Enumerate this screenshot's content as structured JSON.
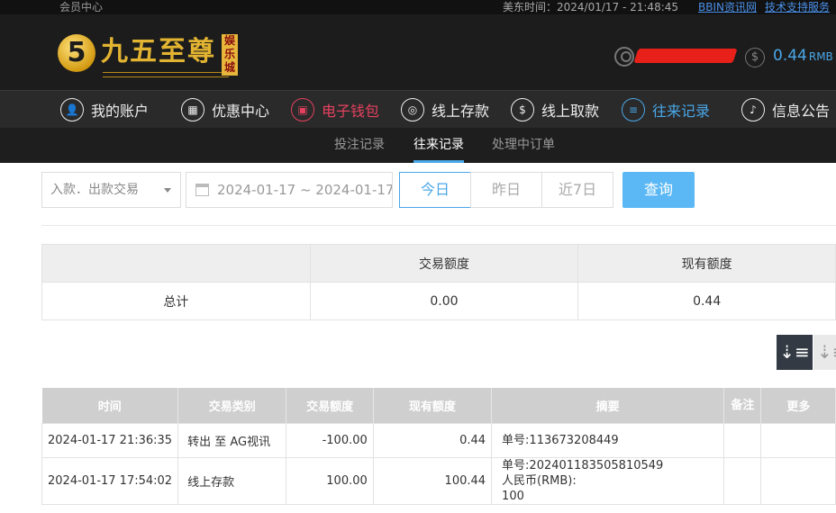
{
  "topbar": {
    "member_center": "会员中心",
    "time": "美东时间：2024/01/17 - 21:48:45",
    "link_bbin": "BBIN资讯网",
    "link_support": "技术支持服务"
  },
  "header": {
    "logo_glyph": "5",
    "logo_text": "九五至尊",
    "logo_badge": "娱乐城",
    "balance": "0.44",
    "currency": "RMB"
  },
  "nav": [
    {
      "label": "我的账户",
      "icon": "user-icon"
    },
    {
      "label": "优惠中心",
      "icon": "gift-icon"
    },
    {
      "label": "电子钱包",
      "icon": "wallet-icon"
    },
    {
      "label": "线上存款",
      "icon": "deposit-icon"
    },
    {
      "label": "线上取款",
      "icon": "withdraw-icon"
    },
    {
      "label": "往来记录",
      "icon": "record-icon"
    },
    {
      "label": "信息公告",
      "icon": "bell-icon"
    }
  ],
  "subnav": [
    "投注记录",
    "往来记录",
    "处理中订单"
  ],
  "filter": {
    "type_selected": "入款．出款交易",
    "date_range": "2024-01-17 ~ 2024-01-17",
    "btn_today": "今日",
    "btn_yesterday": "昨日",
    "btn_7days": "近7日",
    "btn_query": "查询"
  },
  "summary": {
    "headers": [
      "",
      "交易额度",
      "现有额度"
    ],
    "row": [
      "总计",
      "0.00",
      "0.44"
    ]
  },
  "table": {
    "headers": [
      "时间",
      "交易类别",
      "交易额度",
      "现有额度",
      "摘要",
      "备注",
      "更多"
    ],
    "rows": [
      {
        "time": "2024-01-17 21:36:35",
        "type": "转出 至 AG视讯",
        "amount": "-100.00",
        "balance": "0.44",
        "memo1": "单号:113673208449",
        "memo2": "",
        "memo3": ""
      },
      {
        "time": "2024-01-17 17:54:02",
        "type": "线上存款",
        "amount": "100.00",
        "balance": "100.44",
        "memo1": "单号:202401183505810549",
        "memo2": "人民币(RMB):",
        "memo3": "100"
      }
    ]
  },
  "colors": {
    "accent_blue": "#4aa7e8",
    "accent_red": "#e5415f",
    "logo_gold": "#e2b431"
  }
}
